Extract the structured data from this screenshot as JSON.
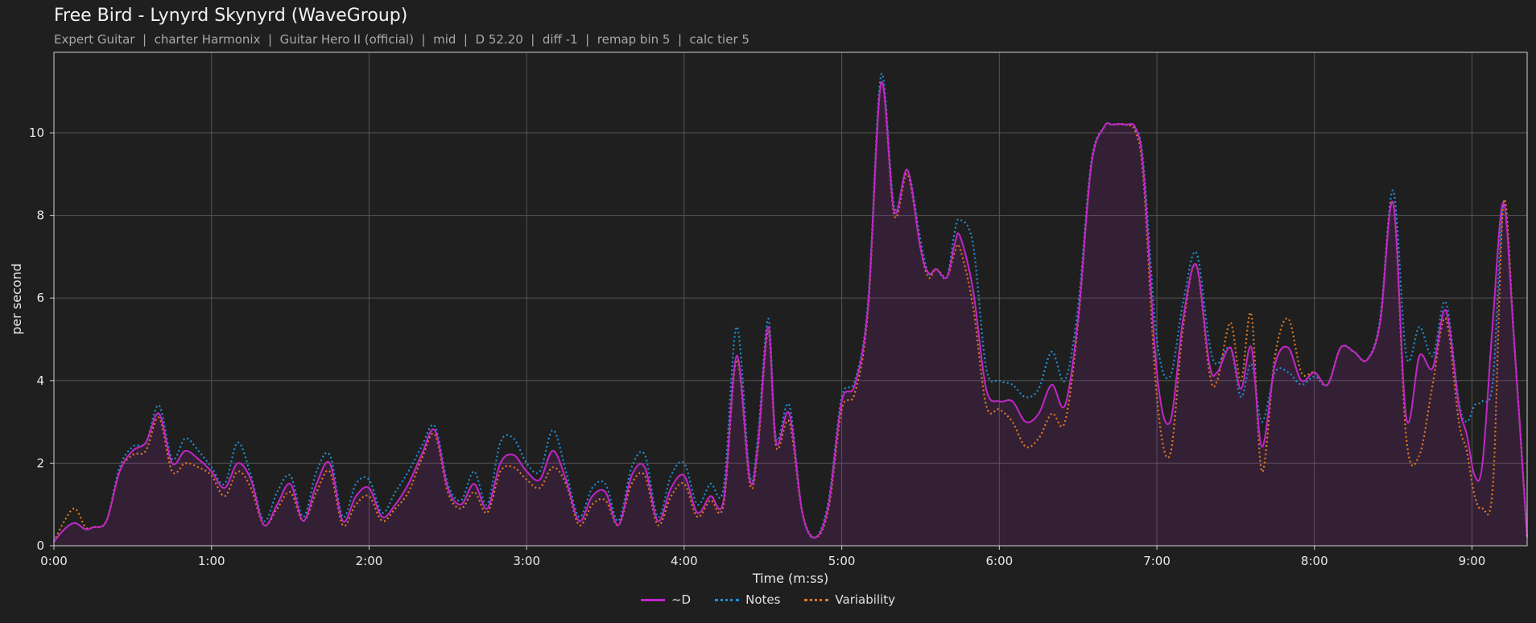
{
  "chart_data": {
    "type": "area",
    "title": "Free Bird - Lynyrd Skynyrd (WaveGroup)",
    "subtitle": "Expert Guitar  |  charter Harmonix  |  Guitar Hero II (official)  |  mid  |  D 52.20  |  diff -1  |  remap bin 5  |  calc tier 5",
    "xlabel": "Time (m:ss)",
    "ylabel": "per second",
    "xlim": [
      0,
      561
    ],
    "ylim": [
      0,
      11.95
    ],
    "x_ticks": [
      0,
      60,
      120,
      180,
      240,
      300,
      360,
      420,
      480,
      540
    ],
    "x_tick_labels": [
      "0:00",
      "1:00",
      "2:00",
      "3:00",
      "4:00",
      "5:00",
      "6:00",
      "7:00",
      "8:00",
      "9:00"
    ],
    "y_ticks": [
      0,
      2,
      4,
      6,
      8,
      10
    ],
    "y_tick_labels": [
      "0",
      "2",
      "4",
      "6",
      "8",
      "10"
    ],
    "grid": true,
    "legend_position": "bottom-center",
    "series": [
      {
        "name": "~D",
        "color": "#c026c6",
        "style": "solid",
        "fill": "rgba(192,38,198,0.13)",
        "x": [
          0,
          4,
          8,
          12,
          15,
          20,
          25,
          30,
          35,
          40,
          45,
          50,
          55,
          60,
          65,
          70,
          75,
          80,
          85,
          90,
          95,
          100,
          105,
          110,
          115,
          120,
          125,
          130,
          135,
          140,
          145,
          150,
          155,
          160,
          165,
          170,
          175,
          180,
          185,
          190,
          195,
          200,
          205,
          210,
          215,
          220,
          225,
          230,
          235,
          240,
          245,
          250,
          255,
          260,
          265,
          268,
          272,
          275,
          280,
          285,
          290,
          295,
          300,
          305,
          310,
          315,
          320,
          325,
          330,
          333,
          336,
          340,
          343,
          345,
          350,
          355,
          360,
          365,
          370,
          375,
          380,
          385,
          390,
          395,
          400,
          403,
          408,
          412,
          415,
          420,
          425,
          430,
          435,
          440,
          443,
          448,
          452,
          456,
          460,
          465,
          470,
          475,
          480,
          485,
          490,
          495,
          500,
          505,
          510,
          515,
          520,
          525,
          530,
          535,
          538,
          541,
          544,
          548,
          552,
          556,
          561
        ],
        "y": [
          0.1,
          0.4,
          0.55,
          0.4,
          0.45,
          0.6,
          1.8,
          2.3,
          2.5,
          3.2,
          2.0,
          2.3,
          2.1,
          1.8,
          1.4,
          2.0,
          1.6,
          0.5,
          1.0,
          1.5,
          0.6,
          1.5,
          2.0,
          0.6,
          1.2,
          1.4,
          0.7,
          1.0,
          1.5,
          2.2,
          2.8,
          1.4,
          1.0,
          1.5,
          0.9,
          2.0,
          2.2,
          1.8,
          1.6,
          2.3,
          1.6,
          0.6,
          1.2,
          1.3,
          0.5,
          1.7,
          1.9,
          0.6,
          1.4,
          1.7,
          0.8,
          1.2,
          1.1,
          4.6,
          1.6,
          2.4,
          5.3,
          2.5,
          3.2,
          0.8,
          0.2,
          1.0,
          3.5,
          3.9,
          5.8,
          11.2,
          8.1,
          9.1,
          7.2,
          6.6,
          6.7,
          6.5,
          7.3,
          7.5,
          6.2,
          3.8,
          3.5,
          3.5,
          3.0,
          3.2,
          3.9,
          3.4,
          5.5,
          9.2,
          10.15,
          10.2,
          10.2,
          10.1,
          9.0,
          4.2,
          3.0,
          5.5,
          6.8,
          4.4,
          4.2,
          4.8,
          3.8,
          4.8,
          2.4,
          4.4,
          4.8,
          4.0,
          4.2,
          3.9,
          4.8,
          4.7,
          4.5,
          5.4,
          8.3,
          3.1,
          4.6,
          4.3,
          5.7,
          3.4,
          2.7,
          1.7,
          2.0,
          5.5,
          8.3,
          5.0,
          0.2
        ]
      },
      {
        "name": "Notes",
        "color": "#1f8fd6",
        "style": "dotted",
        "x": [
          0,
          4,
          8,
          12,
          15,
          20,
          25,
          30,
          35,
          40,
          45,
          50,
          55,
          60,
          65,
          70,
          75,
          80,
          85,
          90,
          95,
          100,
          105,
          110,
          115,
          120,
          125,
          130,
          135,
          140,
          145,
          150,
          155,
          160,
          165,
          170,
          175,
          180,
          185,
          190,
          195,
          200,
          205,
          210,
          215,
          220,
          225,
          230,
          235,
          240,
          245,
          250,
          255,
          260,
          265,
          268,
          272,
          275,
          280,
          285,
          290,
          295,
          300,
          305,
          310,
          315,
          320,
          325,
          330,
          333,
          336,
          340,
          343,
          345,
          350,
          355,
          360,
          365,
          370,
          375,
          380,
          385,
          390,
          395,
          400,
          403,
          408,
          412,
          415,
          420,
          425,
          430,
          435,
          440,
          443,
          448,
          452,
          456,
          460,
          465,
          470,
          475,
          480,
          485,
          490,
          495,
          500,
          505,
          510,
          515,
          520,
          525,
          530,
          535,
          538,
          541,
          544,
          548,
          552,
          556,
          561
        ],
        "y": [
          0.1,
          0.4,
          0.55,
          0.4,
          0.45,
          0.6,
          1.9,
          2.4,
          2.5,
          3.4,
          2.1,
          2.6,
          2.3,
          1.9,
          1.5,
          2.5,
          1.7,
          0.6,
          1.3,
          1.7,
          0.7,
          1.8,
          2.2,
          0.7,
          1.5,
          1.6,
          0.8,
          1.3,
          1.8,
          2.4,
          2.9,
          1.5,
          1.1,
          1.8,
          1.0,
          2.5,
          2.6,
          2.0,
          1.8,
          2.8,
          1.8,
          0.7,
          1.4,
          1.5,
          0.6,
          1.9,
          2.2,
          0.7,
          1.7,
          2.0,
          1.0,
          1.5,
          1.4,
          5.3,
          1.7,
          2.6,
          5.5,
          2.6,
          3.4,
          0.8,
          0.2,
          1.1,
          3.6,
          4.0,
          5.9,
          11.4,
          8.2,
          9.1,
          7.4,
          6.6,
          6.7,
          6.5,
          7.6,
          7.9,
          7.3,
          4.3,
          4.0,
          3.9,
          3.6,
          3.8,
          4.7,
          4.0,
          5.8,
          9.3,
          10.15,
          10.2,
          10.2,
          10.1,
          9.2,
          5.0,
          4.1,
          5.9,
          7.1,
          4.9,
          4.4,
          4.8,
          3.6,
          4.4,
          3.0,
          4.2,
          4.2,
          3.9,
          4.1,
          3.9,
          4.8,
          4.7,
          4.5,
          5.5,
          8.6,
          4.6,
          5.3,
          4.6,
          5.9,
          3.5,
          3.0,
          3.4,
          3.5,
          4.0,
          8.3,
          5.0,
          0.2
        ]
      },
      {
        "name": "Variability",
        "color": "#e07a1f",
        "style": "dotted",
        "x": [
          0,
          4,
          8,
          12,
          15,
          20,
          25,
          30,
          35,
          40,
          45,
          50,
          55,
          60,
          65,
          70,
          75,
          80,
          85,
          90,
          95,
          100,
          105,
          110,
          115,
          120,
          125,
          130,
          135,
          140,
          145,
          150,
          155,
          160,
          165,
          170,
          175,
          180,
          185,
          190,
          195,
          200,
          205,
          210,
          215,
          220,
          225,
          230,
          235,
          240,
          245,
          250,
          255,
          260,
          265,
          268,
          272,
          275,
          280,
          285,
          290,
          295,
          300,
          305,
          310,
          315,
          320,
          325,
          330,
          333,
          336,
          340,
          343,
          345,
          350,
          355,
          360,
          365,
          370,
          375,
          380,
          385,
          390,
          395,
          400,
          403,
          408,
          412,
          415,
          420,
          425,
          430,
          435,
          440,
          443,
          448,
          452,
          456,
          460,
          465,
          470,
          475,
          480,
          485,
          490,
          495,
          500,
          505,
          510,
          515,
          520,
          525,
          530,
          535,
          538,
          541,
          544,
          548,
          552,
          556,
          561
        ],
        "y": [
          0.1,
          0.6,
          0.9,
          0.45,
          0.45,
          0.6,
          1.8,
          2.2,
          2.3,
          3.1,
          1.8,
          2.0,
          1.9,
          1.7,
          1.2,
          1.8,
          1.4,
          0.5,
          0.9,
          1.3,
          0.6,
          1.3,
          1.8,
          0.5,
          1.0,
          1.2,
          0.6,
          0.9,
          1.3,
          2.1,
          2.7,
          1.3,
          0.9,
          1.3,
          0.8,
          1.8,
          1.9,
          1.6,
          1.4,
          1.9,
          1.5,
          0.5,
          1.0,
          1.1,
          0.5,
          1.5,
          1.7,
          0.5,
          1.2,
          1.5,
          0.7,
          1.1,
          1.0,
          4.5,
          1.5,
          2.3,
          5.2,
          2.4,
          3.0,
          0.8,
          0.2,
          0.9,
          3.3,
          3.7,
          5.7,
          11.2,
          8.0,
          9.0,
          7.2,
          6.5,
          6.7,
          6.5,
          7.1,
          7.2,
          5.8,
          3.4,
          3.3,
          3.0,
          2.4,
          2.6,
          3.2,
          3.0,
          5.4,
          9.2,
          10.15,
          10.2,
          10.2,
          10.0,
          8.8,
          3.6,
          2.2,
          5.3,
          6.8,
          4.2,
          4.0,
          5.4,
          4.0,
          5.6,
          1.8,
          4.6,
          5.5,
          4.2,
          4.2,
          3.9,
          4.8,
          4.7,
          4.5,
          5.4,
          8.3,
          2.6,
          2.2,
          3.9,
          5.5,
          3.0,
          2.3,
          1.2,
          0.9,
          1.5,
          8.3,
          5.0,
          0.2
        ]
      }
    ]
  }
}
